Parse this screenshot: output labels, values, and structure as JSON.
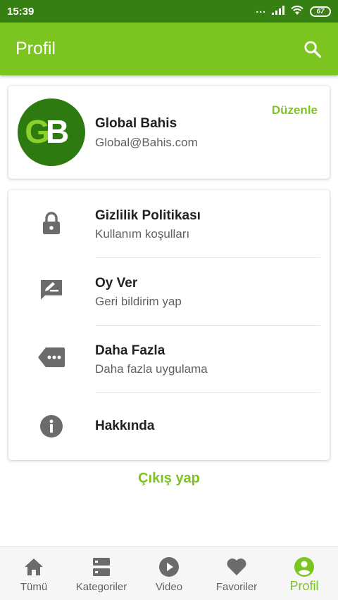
{
  "status_bar": {
    "time": "15:39",
    "dots": "...",
    "battery": "67"
  },
  "app_bar": {
    "title": "Profil"
  },
  "profile": {
    "logo_text": "GB",
    "name": "Global Bahis",
    "email": "Global@Bahis.com",
    "edit_label": "Düzenle"
  },
  "menu": {
    "items": [
      {
        "icon": "lock-icon",
        "title": "Gizlilik Politikası",
        "subtitle": "Kullanım koşulları"
      },
      {
        "icon": "rate-review-icon",
        "title": "Oy Ver",
        "subtitle": "Geri bildirim yap"
      },
      {
        "icon": "more-tag-icon",
        "title": "Daha Fazla",
        "subtitle": "Daha fazla uygulama"
      },
      {
        "icon": "info-icon",
        "title": "Hakkında",
        "subtitle": ""
      }
    ]
  },
  "logout_label": "Çıkış yap",
  "bottom_nav": {
    "items": [
      {
        "icon": "home-icon",
        "label": "Tümü",
        "active": false
      },
      {
        "icon": "categories-icon",
        "label": "Kategoriler",
        "active": false
      },
      {
        "icon": "play-icon",
        "label": "Video",
        "active": false
      },
      {
        "icon": "heart-icon",
        "label": "Favoriler",
        "active": false
      },
      {
        "icon": "account-icon",
        "label": "Profil",
        "active": true
      }
    ]
  },
  "colors": {
    "status_bar": "#367f12",
    "primary": "#7cc521",
    "icon_gray": "#6b6b6b",
    "logo_dark": "#2d7a10"
  }
}
